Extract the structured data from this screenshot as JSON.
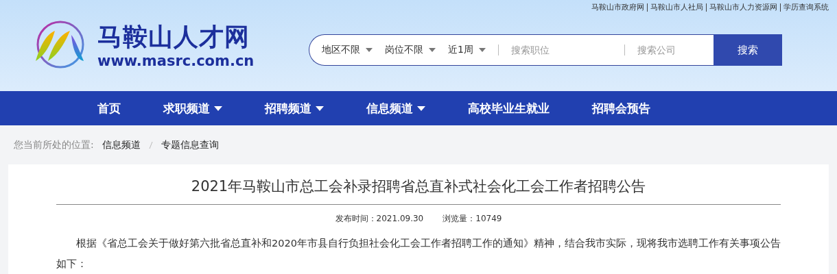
{
  "top_links": [
    "马鞍山市政府网",
    "马鞍山市人社局",
    "马鞍山市人力资源网",
    "学历查询系统"
  ],
  "logo": {
    "name": "马鞍山人才网",
    "url": "www.masrc.com.cn"
  },
  "search": {
    "filters": [
      "地区不限",
      "岗位不限",
      "近1周"
    ],
    "job_placeholder": "搜索职位",
    "company_placeholder": "搜索公司",
    "button": "搜索"
  },
  "nav": [
    {
      "label": "首页",
      "dropdown": false
    },
    {
      "label": "求职频道",
      "dropdown": true
    },
    {
      "label": "招聘频道",
      "dropdown": true
    },
    {
      "label": "信息频道",
      "dropdown": true
    },
    {
      "label": "高校毕业生就业",
      "dropdown": false
    },
    {
      "label": "招聘会预告",
      "dropdown": false
    }
  ],
  "breadcrumb": {
    "prefix": "您当前所处的位置:",
    "items": [
      "信息频道",
      "专题信息查询"
    ]
  },
  "article": {
    "title": "2021年马鞍山市总工会补录招聘省总直补式社会化工会工作者招聘公告",
    "published": "发布时间：2021.09.30",
    "views": "浏览量：10749",
    "paragraphs": [
      "根据《省总工会关于做好第六批省总直补和2020年市县自行负担社会化工会工作者招聘工作的通知》精神，结合我市实际，现将我市选聘工作有关事项公告如下："
    ]
  }
}
